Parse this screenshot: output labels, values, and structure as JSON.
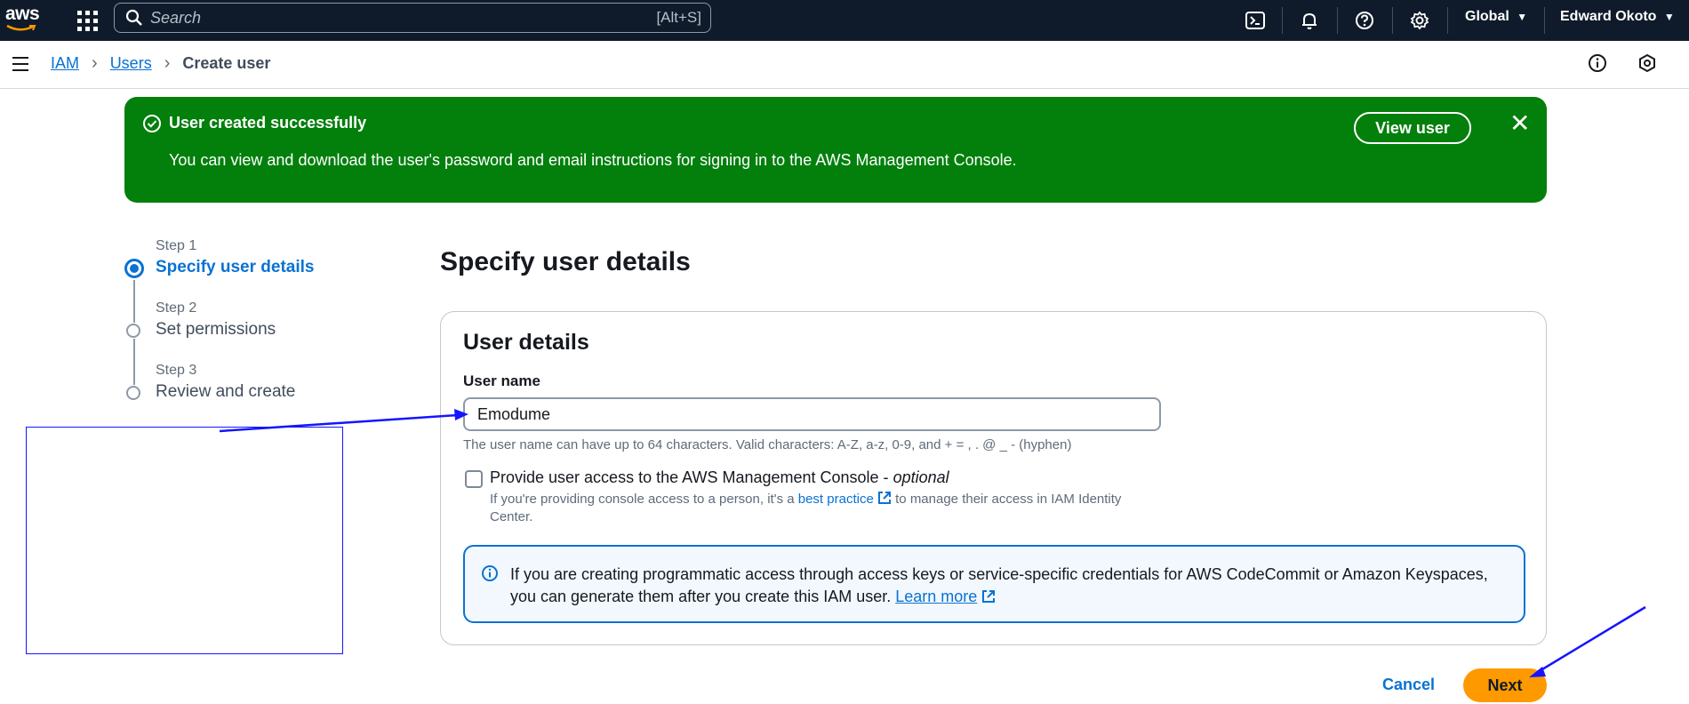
{
  "topnav": {
    "logo_text": "aws",
    "search_placeholder": "Search",
    "search_shortcut": "[Alt+S]",
    "region": "Global",
    "user": "Edward Okoto",
    "icons": [
      "cloudshell-icon",
      "bell-icon",
      "help-icon",
      "gear-icon"
    ]
  },
  "breadcrumb": {
    "items": [
      "IAM",
      "Users"
    ],
    "current": "Create user"
  },
  "flash": {
    "title": "User created successfully",
    "message": "You can view and download the user's password and email instructions for signing in to the AWS Management Console.",
    "view_button": "View user",
    "color": "#037f0c"
  },
  "steps": [
    {
      "label": "Step 1",
      "name": "Specify user details",
      "active": true
    },
    {
      "label": "Step 2",
      "name": "Set permissions",
      "active": false
    },
    {
      "label": "Step 3",
      "name": "Review and create",
      "active": false
    }
  ],
  "main": {
    "title": "Specify user details",
    "panel_title": "User details",
    "username_label": "User name",
    "username_value": "Emodume",
    "username_hint": "The user name can have up to 64 characters. Valid characters: A-Z, a-z, 0-9, and + = , . @ _ - (hyphen)",
    "console_access_label": "Provide user access to the AWS Management Console - ",
    "console_access_optional": "optional",
    "console_access_checked": false,
    "console_desc_pre": "If you're providing console access to a person, it's a ",
    "console_desc_link": "best practice",
    "console_desc_post": " to manage their access in IAM Identity Center.",
    "info_text": "If you are creating programmatic access through access keys or service-specific credentials for AWS CodeCommit or Amazon Keyspaces, you can generate them after you create this IAM user. ",
    "info_link": "Learn more"
  },
  "actions": {
    "cancel": "Cancel",
    "next": "Next",
    "accent": "#ff9900"
  }
}
